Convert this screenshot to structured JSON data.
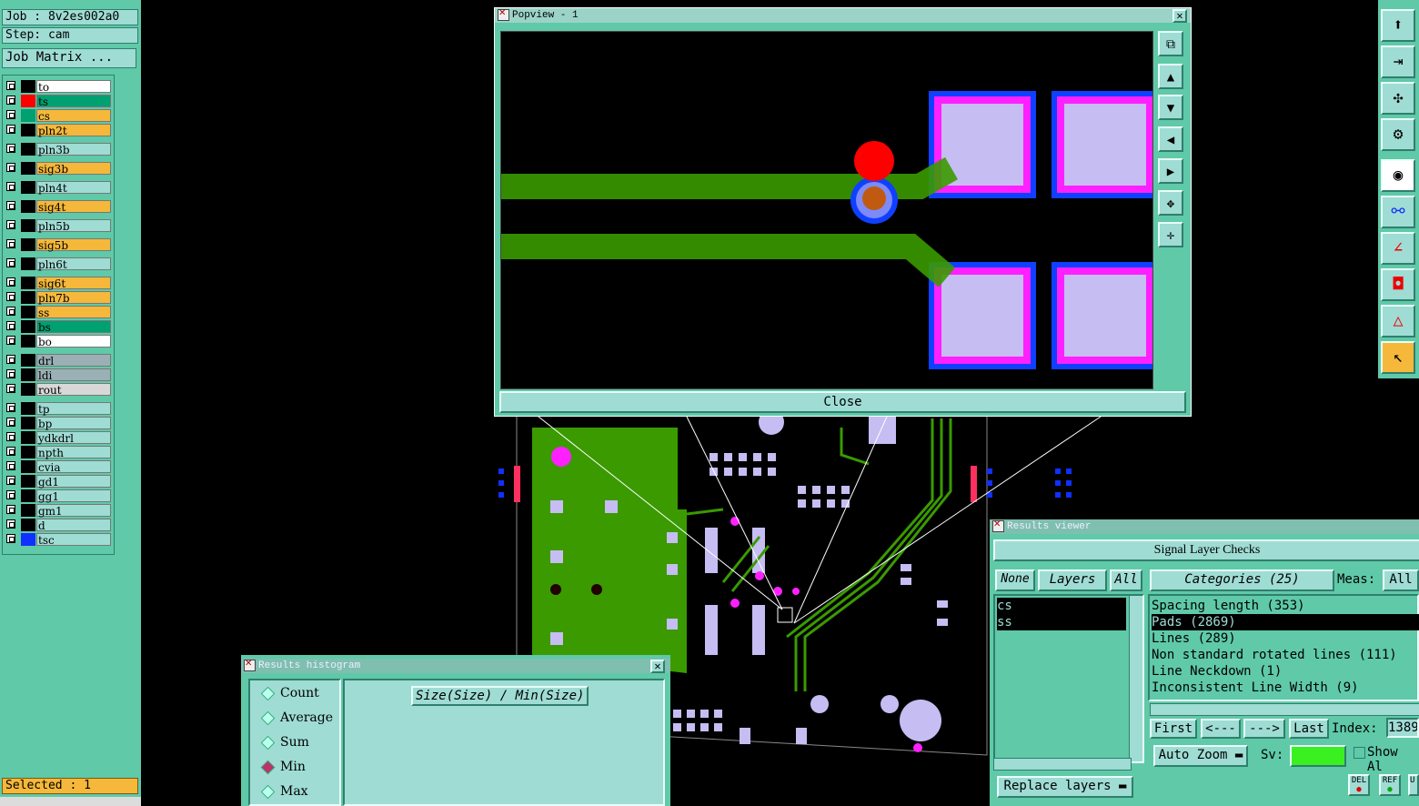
{
  "job": {
    "job_line": "Job : 8v2es002a0",
    "step_line": "Step: cam",
    "matrix_button": "Job Matrix ..."
  },
  "layers": [
    {
      "name": "to",
      "color": "#ffffff",
      "swatch": "#000000"
    },
    {
      "name": "ts",
      "color": "#00a070",
      "swatch": "#ff0000"
    },
    {
      "name": "cs",
      "color": "#f5b83a",
      "swatch": "#00a070"
    },
    {
      "name": "pln2t",
      "color": "#f5b83a",
      "swatch": "#000000"
    },
    {
      "name": "pln3b",
      "color": "#9fdcd4",
      "swatch": "#000000"
    },
    {
      "name": "sig3b",
      "color": "#f5b83a",
      "swatch": "#000000"
    },
    {
      "name": "pln4t",
      "color": "#9fdcd4",
      "swatch": "#000000"
    },
    {
      "name": "sig4t",
      "color": "#f5b83a",
      "swatch": "#000000"
    },
    {
      "name": "pln5b",
      "color": "#9fdcd4",
      "swatch": "#000000"
    },
    {
      "name": "sig5b",
      "color": "#f5b83a",
      "swatch": "#000000"
    },
    {
      "name": "pln6t",
      "color": "#9fdcd4",
      "swatch": "#000000"
    },
    {
      "name": "sig6t",
      "color": "#f5b83a",
      "swatch": "#000000"
    },
    {
      "name": "pln7b",
      "color": "#f5b83a",
      "swatch": "#000000"
    },
    {
      "name": "ss",
      "color": "#f5b83a",
      "swatch": "#000000"
    },
    {
      "name": "bs",
      "color": "#00a070",
      "swatch": "#000000"
    },
    {
      "name": "bo",
      "color": "#ffffff",
      "swatch": "#000000"
    },
    {
      "name": "drl",
      "color": "#9ab0b5",
      "swatch": "#000000"
    },
    {
      "name": "ldi",
      "color": "#9ab0b5",
      "swatch": "#000000"
    },
    {
      "name": "rout",
      "color": "#d8d8d8",
      "swatch": "#000000"
    },
    {
      "name": "tp",
      "color": "#9fdcd4",
      "swatch": "#000000"
    },
    {
      "name": "bp",
      "color": "#9fdcd4",
      "swatch": "#000000"
    },
    {
      "name": "ydkdrl",
      "color": "#9fdcd4",
      "swatch": "#000000"
    },
    {
      "name": "npth",
      "color": "#9fdcd4",
      "swatch": "#000000"
    },
    {
      "name": "cvia",
      "color": "#9fdcd4",
      "swatch": "#000000"
    },
    {
      "name": "gd1",
      "color": "#9fdcd4",
      "swatch": "#000000"
    },
    {
      "name": "gg1",
      "color": "#9fdcd4",
      "swatch": "#000000"
    },
    {
      "name": "gm1",
      "color": "#9fdcd4",
      "swatch": "#000000"
    },
    {
      "name": "d",
      "color": "#9fdcd4",
      "swatch": "#000000"
    },
    {
      "name": "tsc",
      "color": "#9fdcd4",
      "swatch": "#1030ff"
    }
  ],
  "selected": "Selected : 1",
  "popview": {
    "title": "Popview - 1",
    "close_label": "Close"
  },
  "results_viewer": {
    "title": "Results viewer",
    "heading": "Signal Layer Checks",
    "none_label": "None",
    "layers_label": "Layers",
    "all_label": "All",
    "categories_label": "Categories (25)",
    "meas_label": "Meas:",
    "meas_value": "All",
    "layer_items": [
      "cs",
      "ss"
    ],
    "categories": [
      "Spacing length (353)",
      "Pads (2869)",
      "Lines (289)",
      "Non standard rotated lines (111)",
      "Line Neckdown (1)",
      "Inconsistent Line Width (9)"
    ],
    "first_label": "First",
    "prev_label": "<---",
    "next_label": "--->",
    "last_label": "Last",
    "index_label": "Index:",
    "index_value": "1389",
    "auto_zoom_label": "Auto Zoom",
    "sv_label": "Sv:",
    "show_label": "Show Al",
    "replace_layers_label": "Replace layers",
    "del_label": "DEL",
    "ref_label": "REF",
    "u_label": "U"
  },
  "histogram": {
    "title": "Results histogram",
    "options": [
      "Count",
      "Average",
      "Sum",
      "Min",
      "Max"
    ],
    "selected_option": "Min",
    "expression": "Size(Size) / Min(Size)"
  },
  "colors": {
    "ui_bg": "#5fc9a8",
    "panel": "#9fdcd4",
    "copper": "#3a9a00",
    "pad_fill": "#c6bdf2",
    "pad_ring": "#ff20ff",
    "pad_mask": "#1040ff",
    "highlight": "#f5b83a"
  }
}
